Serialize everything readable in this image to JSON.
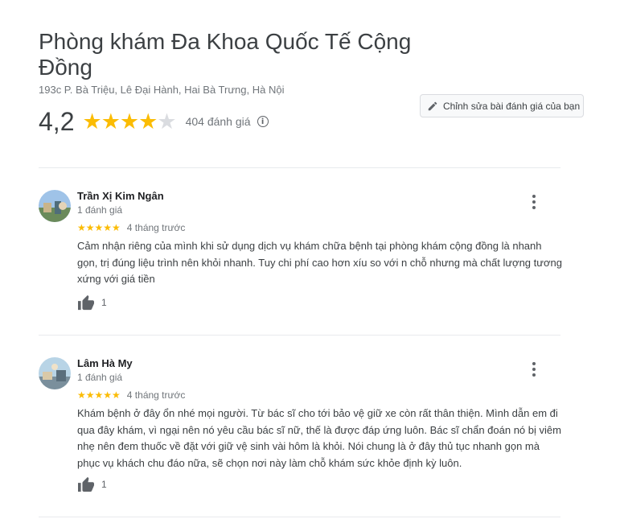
{
  "place": {
    "name": "Phòng khám Đa Khoa Quốc Tế Cộng Đồng",
    "address": "193c P. Bà Triệu, Lê Đại Hành, Hai Bà Trưng, Hà Nội",
    "rating": "4,2",
    "rating_value": 4.2,
    "review_count_label": "404 đánh giá",
    "info_icon": "info-icon"
  },
  "edit_button": {
    "label": "Chỉnh sửa bài đánh giá của bạn",
    "icon": "pencil-icon"
  },
  "colors": {
    "star": "#fbbc04",
    "star_off": "#dadce0",
    "text": "#3c4043",
    "muted": "#70757a"
  },
  "reviews": [
    {
      "author": "Trần Xị Kim Ngân",
      "meta": "1 đánh giá",
      "stars": "★★★★★",
      "star_count": 5,
      "time": "4 tháng trước",
      "text": "Cảm nhận riêng của mình khi sử dụng dịch vụ khám chữa bệnh tại phòng khám cộng đồng là nhanh gọn, trị đúng liệu trình nên khỏi nhanh. Tuy chi phí cao hơn xíu so với n chỗ nhưng mà chất lượng tương xứng với giá tiền",
      "likes": "1"
    },
    {
      "author": "Lâm Hà My",
      "meta": "1 đánh giá",
      "stars": "★★★★★",
      "star_count": 5,
      "time": "4 tháng trước",
      "text": "Khám bệnh ở đây ổn nhé mọi người. Từ bác sĩ cho tới bảo vệ giữ xe còn rất thân thiện. Mình dẫn em đi qua đây khám, vì ngại nên nó yêu cầu bác sĩ nữ, thế là được đáp ứng luôn. Bác sĩ chẩn đoán nó bị viêm nhẹ nên đem thuốc về đặt với giữ vệ sinh vài hôm là khỏi. Nói chung là ở đây thủ tục nhanh gọn  mà phục vụ khách chu đáo nữa, sẽ chọn nơi này làm chỗ khám sức khỏe định kỳ luôn.",
      "likes": "1"
    }
  ]
}
